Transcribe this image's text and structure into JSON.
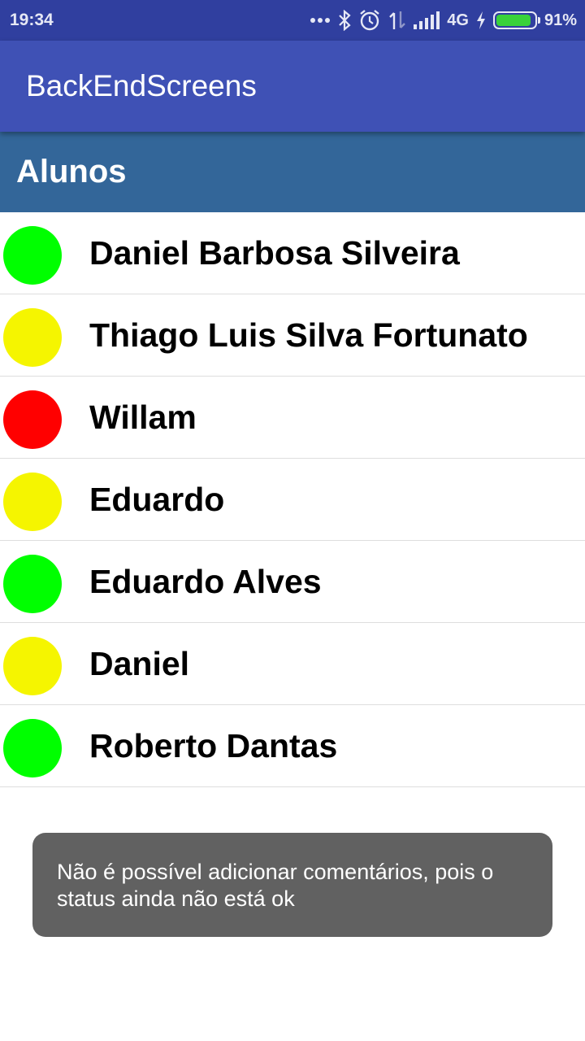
{
  "status_bar": {
    "time": "19:34",
    "network": "4G",
    "battery": "91%",
    "battery_level": 0.91,
    "icons": [
      "more-dots-icon",
      "bluetooth-icon",
      "alarm-icon",
      "data-transfer-icon",
      "signal-icon",
      "charging-bolt-icon",
      "battery-icon"
    ]
  },
  "app_bar": {
    "title": "BackEndScreens"
  },
  "section": {
    "title": "Alunos"
  },
  "students": [
    {
      "name": "Daniel Barbosa Silveira",
      "status_color": "#00ff00"
    },
    {
      "name": "Thiago Luis Silva Fortunato",
      "status_color": "#f5f500"
    },
    {
      "name": "Willam",
      "status_color": "#ff0000"
    },
    {
      "name": "Eduardo",
      "status_color": "#f5f500"
    },
    {
      "name": "Eduardo Alves",
      "status_color": "#00ff00"
    },
    {
      "name": "Daniel",
      "status_color": "#f5f500"
    },
    {
      "name": "Roberto Dantas",
      "status_color": "#00ff00"
    }
  ],
  "toast": {
    "message": "Não é possível adicionar comentários, pois o status ainda não está ok"
  },
  "colors": {
    "status_bar": "#303F9F",
    "app_bar": "#3F51B5",
    "section_header": "#336699",
    "toast": "#616161"
  }
}
